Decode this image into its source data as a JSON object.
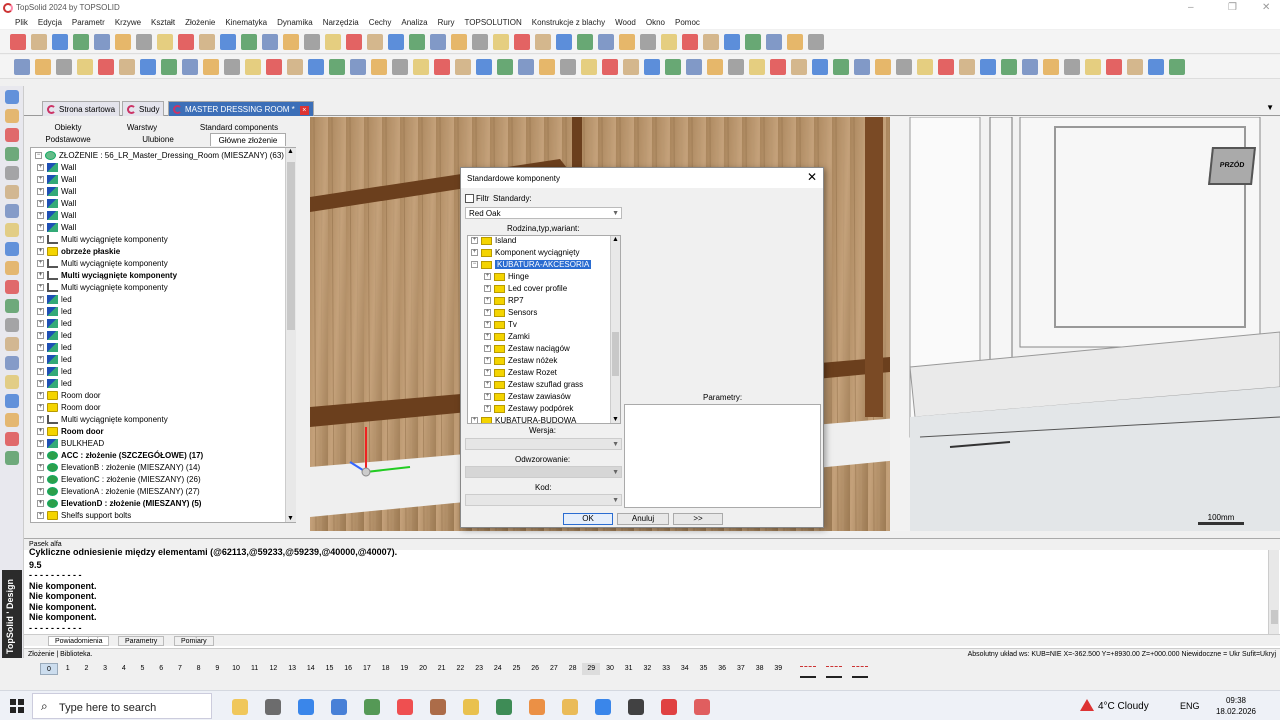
{
  "window": {
    "title": "TopSolid 2024 by TOPSOLID"
  },
  "menu": [
    "Plik",
    "Edycja",
    "Parametr",
    "Krzywe",
    "Kształt",
    "Złożenie",
    "Kinematyka",
    "Dynamika",
    "Narzędzia",
    "Cechy",
    "Analiza",
    "Rury",
    "TOPSOLUTION",
    "Konstrukcje z blachy",
    "Wood",
    "Okno",
    "Pomoc"
  ],
  "doc_tabs": [
    {
      "label": "Strona startowa"
    },
    {
      "label": "Study"
    },
    {
      "label": "MASTER DRESSING ROOM *",
      "close": "×"
    }
  ],
  "panel_tabs": {
    "row1": [
      "Obiekty",
      "Warstwy",
      "Standard components"
    ],
    "row2": [
      "Podstawowe",
      "Ulubione",
      "Główne złożenie"
    ]
  },
  "tree": {
    "root": "ZŁOŻENIE : 56_LR_Master_Dressing_Room (MIESZANY) (63)",
    "items": [
      {
        "label": "Wall",
        "icon": "wall"
      },
      {
        "label": "Wall",
        "icon": "wall"
      },
      {
        "label": "Wall",
        "icon": "wall"
      },
      {
        "label": "Wall",
        "icon": "wall"
      },
      {
        "label": "Wall",
        "icon": "wall"
      },
      {
        "label": "Wall",
        "icon": "wall"
      },
      {
        "label": "Multi wyciągnięte komponenty",
        "icon": "multi"
      },
      {
        "label": "obrzeże płaskie",
        "icon": "folder",
        "bold": true
      },
      {
        "label": "Multi wyciągnięte komponenty",
        "icon": "multi"
      },
      {
        "label": "Multi wyciągnięte komponenty",
        "icon": "multi",
        "bold": true
      },
      {
        "label": "Multi wyciągnięte komponenty",
        "icon": "multi"
      },
      {
        "label": "led",
        "icon": "wall"
      },
      {
        "label": "led",
        "icon": "wall"
      },
      {
        "label": "led",
        "icon": "wall"
      },
      {
        "label": "led",
        "icon": "wall"
      },
      {
        "label": "led",
        "icon": "wall"
      },
      {
        "label": "led",
        "icon": "wall"
      },
      {
        "label": "led",
        "icon": "wall"
      },
      {
        "label": "led",
        "icon": "wall"
      },
      {
        "label": "Room door",
        "icon": "folder"
      },
      {
        "label": "Room door",
        "icon": "folder"
      },
      {
        "label": "Multi wyciągnięte komponenty",
        "icon": "multi"
      },
      {
        "label": "Room door",
        "icon": "folder",
        "bold": true
      },
      {
        "label": "BULKHEAD",
        "icon": "wall"
      },
      {
        "label": "ACC : złożenie (SZCZEGÓŁOWE) (17)",
        "icon": "asm",
        "bold": true
      },
      {
        "label": "ElevationB : złożenie (MIESZANY) (14)",
        "icon": "asm"
      },
      {
        "label": "ElevationC : złożenie (MIESZANY) (26)",
        "icon": "asm"
      },
      {
        "label": "ElevationA : złożenie (MIESZANY) (27)",
        "icon": "asm"
      },
      {
        "label": "ElevationD : złożenie (MIESZANY) (5)",
        "icon": "asm",
        "bold": true
      },
      {
        "label": "Shelfs support bolts",
        "icon": "folder"
      }
    ]
  },
  "dialog": {
    "title": "Standardowe komponenty",
    "close": "✕",
    "filter_label": "Filtr",
    "standards_label": "Standardy:",
    "standard_value": "Red Oak",
    "family_label": "Rodzina,typ,wariant:",
    "list": [
      {
        "label": "Island",
        "level": 0
      },
      {
        "label": "Komponent wyciągnięty",
        "level": 0
      },
      {
        "label": "KUBATURA-AKCESORIA",
        "level": 0,
        "selected": true,
        "expanded": true
      },
      {
        "label": "Hinge",
        "level": 1
      },
      {
        "label": "Led cover profile",
        "level": 1
      },
      {
        "label": "RP7",
        "level": 1
      },
      {
        "label": "Sensors",
        "level": 1
      },
      {
        "label": "Tv",
        "level": 1
      },
      {
        "label": "Zamki",
        "level": 1
      },
      {
        "label": "Zestaw naciągów",
        "level": 1
      },
      {
        "label": "Zestaw nóżek",
        "level": 1
      },
      {
        "label": "Zestaw Rozet",
        "level": 1
      },
      {
        "label": "Zestaw szuflad grass",
        "level": 1
      },
      {
        "label": "Zestaw zawiasów",
        "level": 1
      },
      {
        "label": "Zestawy podpórek",
        "level": 1
      },
      {
        "label": "KUBATURA-BUDOWA",
        "level": 0
      }
    ],
    "version_label": "Wersja:",
    "mapping_label": "Odwzorowanie:",
    "code_label": "Kod:",
    "params_label": "Parametry:",
    "ok": "OK",
    "cancel": "Anuluj",
    "more": ">>"
  },
  "viewport": {
    "front_label": "PRZÓD",
    "scale": "100mm"
  },
  "alpha": {
    "title": "Pasek alfa",
    "lines": [
      "Cykliczne odniesienie między elementami (@62113,@59233,@59239,@40000,@40007).",
      "9.5",
      "- - - - - - - - - -",
      "Nie komponent.",
      "Nie komponent.",
      "Nie komponent.",
      "Nie komponent.",
      "- - - - - - - - - -"
    ]
  },
  "bottom_tabs": [
    "Powiadomienia",
    "Parametry",
    "Pomiary"
  ],
  "status": {
    "left": "Złożenie | Biblioteka.",
    "right": "Absolutny układ ws: KUB=NIE  X=-362.500  Y=+8930.00  Z=+000.000  Niewidoczne = Ukr  Sufit=Ukryj"
  },
  "layers": [
    "0",
    "1",
    "2",
    "3",
    "4",
    "5",
    "6",
    "7",
    "8",
    "9",
    "10",
    "11",
    "12",
    "13",
    "14",
    "15",
    "16",
    "17",
    "18",
    "19",
    "20",
    "21",
    "22",
    "23",
    "24",
    "25",
    "26",
    "27",
    "28",
    "29",
    "30",
    "31",
    "32",
    "33",
    "34",
    "35",
    "36",
    "37",
    "38",
    "39"
  ],
  "taskbar": {
    "search_placeholder": "Type here to search",
    "weather": "4°C  Cloudy",
    "lang": "ENG",
    "time": "09:38",
    "date": "18.02.2026"
  }
}
